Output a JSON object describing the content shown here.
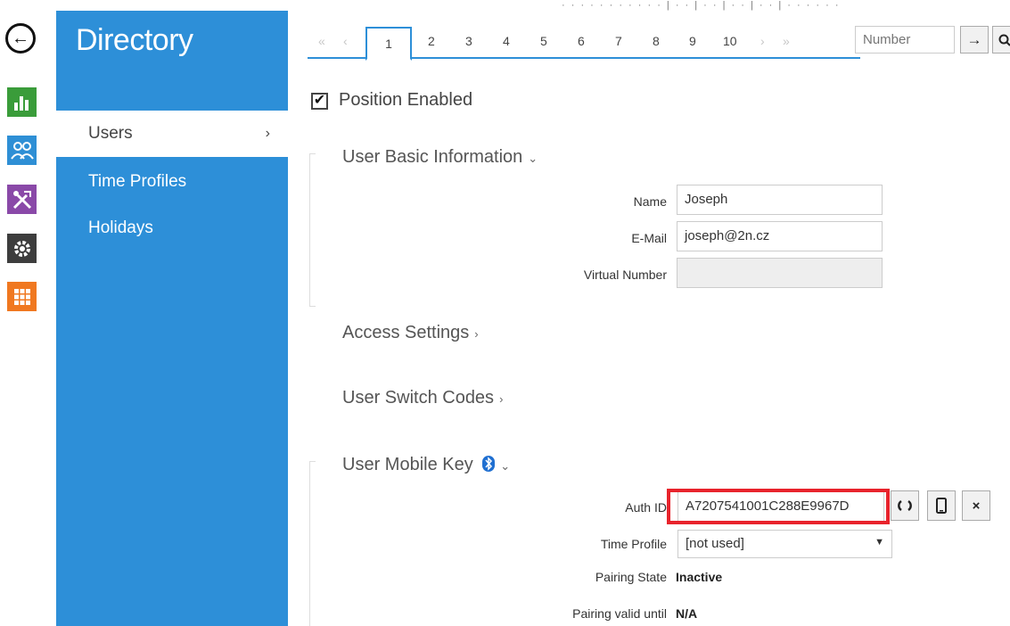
{
  "rail": {
    "back_glyph": "←",
    "icons": [
      "dashboard-icon",
      "users-icon",
      "tools-icon",
      "gear-icon",
      "apps-icon"
    ]
  },
  "sidebar": {
    "title": "Directory",
    "items": [
      {
        "label": "Users",
        "chevron": "›"
      },
      {
        "label": "Time Profiles"
      },
      {
        "label": "Holidays"
      }
    ]
  },
  "topbar": {
    "clipped_text": "· · · · · · · · ·   · · | · · | · · | · · | · · | · ·              · · · ·"
  },
  "pager": {
    "first": "«",
    "prev": "‹",
    "active": "1",
    "pages": [
      "2",
      "3",
      "4",
      "5",
      "6",
      "7",
      "8",
      "9",
      "10"
    ],
    "next": "›",
    "last": "»",
    "number_placeholder": "Number",
    "go_glyph": "→"
  },
  "position": {
    "checked": true,
    "label": "Position Enabled"
  },
  "basic_info": {
    "title": "User Basic Information",
    "caret": "⌄",
    "name_label": "Name",
    "name_value": "Joseph",
    "email_label": "E-Mail",
    "email_value": "joseph@2n.cz",
    "virtual_label": "Virtual Number",
    "virtual_value": ""
  },
  "access_settings": {
    "title": "Access Settings",
    "caret": "›"
  },
  "switch_codes": {
    "title": "User Switch Codes",
    "caret": "›"
  },
  "mobile_key": {
    "title": "User Mobile Key",
    "caret": "⌄",
    "auth_label": "Auth ID",
    "auth_value": "A7207541001C288E9967D",
    "time_profile_label": "Time Profile",
    "time_profile_value": "[not used]",
    "pairing_state_label": "Pairing State",
    "pairing_state_value": "Inactive",
    "pairing_valid_label": "Pairing valid until",
    "pairing_valid_value": "N/A",
    "clear_glyph": "×"
  },
  "colors": {
    "accent": "#2d8fd8",
    "highlight": "#e8232c"
  }
}
